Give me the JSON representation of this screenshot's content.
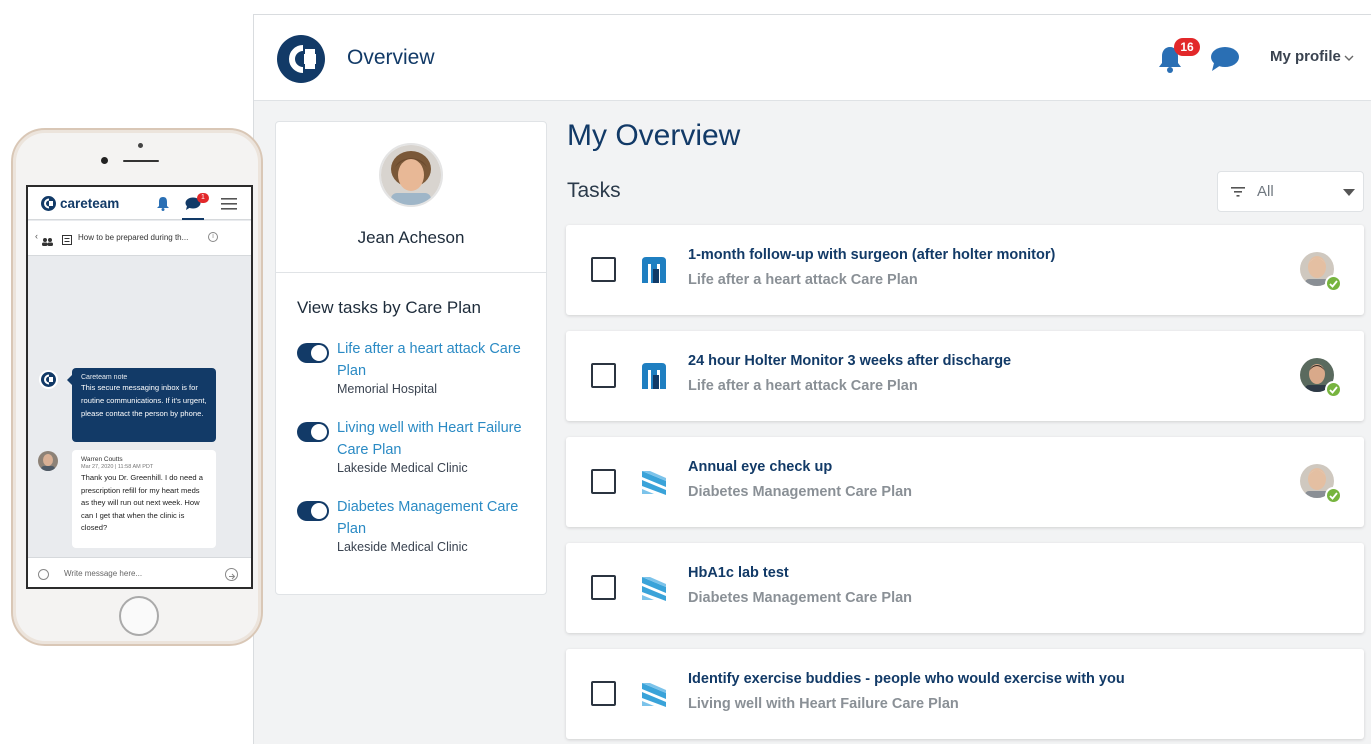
{
  "app": {
    "title": "Overview",
    "notifications_count": "16",
    "profile_label": "My profile",
    "colors": {
      "navy": "#123a67",
      "link": "#2a8ac4",
      "badge": "#e2282a",
      "check": "#77b43f"
    }
  },
  "patient": {
    "name": "Jean Acheson"
  },
  "care_plans": {
    "heading": "View tasks by Care Plan",
    "items": [
      {
        "label": "Life after a heart attack Care Plan",
        "org": "Memorial Hospital",
        "enabled": true
      },
      {
        "label": "Living well with Heart Failure Care Plan",
        "org": "Lakeside Medical Clinic",
        "enabled": true
      },
      {
        "label": "Diabetes Management Care Plan",
        "org": "Lakeside Medical Clinic",
        "enabled": true
      }
    ]
  },
  "overview": {
    "title": "My Overview",
    "tasks_heading": "Tasks",
    "filter_value": "All"
  },
  "tasks": [
    {
      "title": "1-month follow-up with surgeon (after holter monitor)",
      "plan": "Life after a heart attack Care Plan",
      "icon": "hospital-m-icon",
      "assigned": true
    },
    {
      "title": "24 hour Holter Monitor 3 weeks after discharge",
      "plan": "Life after a heart attack Care Plan",
      "icon": "hospital-m-icon",
      "assigned": true
    },
    {
      "title": "Annual eye check up",
      "plan": "Diabetes Management Care Plan",
      "icon": "clinic-stripes-icon",
      "assigned": true
    },
    {
      "title": "HbA1c lab test",
      "plan": "Diabetes Management Care Plan",
      "icon": "clinic-stripes-icon",
      "assigned": false
    },
    {
      "title": "Identify exercise buddies - people who would exercise with you",
      "plan": "Living well with Heart Failure Care Plan",
      "icon": "clinic-stripes-icon",
      "assigned": false
    }
  ],
  "phone": {
    "brand": "careteam",
    "message_badge": "1",
    "conversation_title": "How to be prepared during th...",
    "note": {
      "label": "Careteam note",
      "text": "This secure messaging inbox is for routine communications. If it's urgent, please contact the person by phone."
    },
    "message": {
      "sender": "Warren Coutts",
      "time": "Mar 27, 2020 | 11:58 AM PDT",
      "text": "Thank you Dr. Greenhill. I do need a prescription refill for my heart meds as they will run out next week. How can I get that when the clinic is closed?"
    },
    "compose_placeholder": "Write message here..."
  }
}
